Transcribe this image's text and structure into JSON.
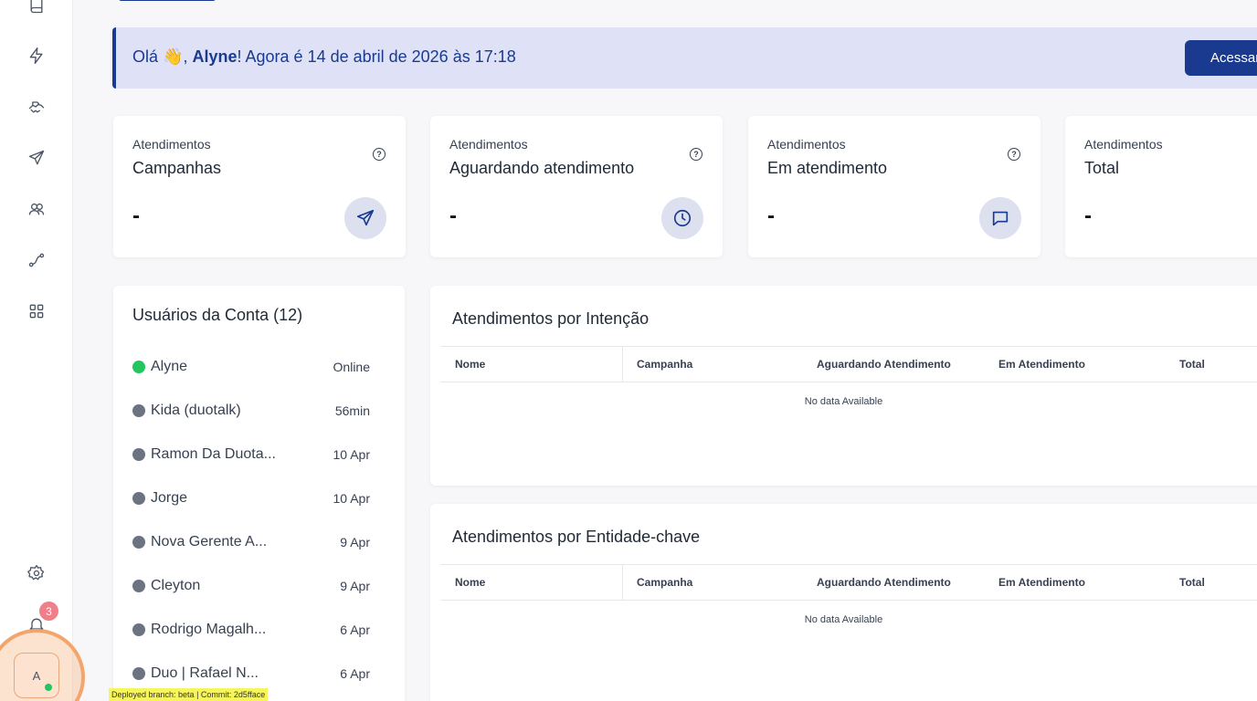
{
  "sidebar": {
    "icons": [
      "book-icon",
      "bolt-icon",
      "handshake-icon",
      "send-icon",
      "users-icon",
      "flow-icon",
      "grid-icon",
      "gear-icon",
      "bell-icon"
    ],
    "notification_count": "3",
    "avatar_initial": "A"
  },
  "banner": {
    "greeting": "Olá",
    "wave": "👋",
    "comma": ",",
    "user": "Alyne",
    "message": "! Agora é 14 de abril de 2026 às 17:18",
    "button": "Acessar"
  },
  "cards": [
    {
      "label": "Atendimentos",
      "title": "Campanhas",
      "value": "-",
      "icon": "send-icon",
      "help": "?"
    },
    {
      "label": "Atendimentos",
      "title": "Aguardando atendimento",
      "value": "-",
      "icon": "clock-icon",
      "help": "?"
    },
    {
      "label": "Atendimentos",
      "title": "Em atendimento",
      "value": "-",
      "icon": "chat-icon",
      "help": "?"
    },
    {
      "label": "Atendimentos",
      "title": "Total",
      "value": "-"
    }
  ],
  "users": {
    "title": "Usuários da Conta (12)",
    "list": [
      {
        "name": "Alyne",
        "time": "Online"
      },
      {
        "name": "Kida (duotalk)",
        "time": "56min"
      },
      {
        "name": "Ramon Da Duota...",
        "time": "10 Apr"
      },
      {
        "name": "Jorge",
        "time": "10 Apr"
      },
      {
        "name": "Nova Gerente A...",
        "time": "9 Apr"
      },
      {
        "name": "Cleyton",
        "time": "9 Apr"
      },
      {
        "name": "Rodrigo Magalh...",
        "time": "6 Apr"
      },
      {
        "name": "Duo | Rafael N...",
        "time": "6 Apr"
      }
    ]
  },
  "tables": [
    {
      "title": "Atendimentos por Intenção",
      "columns": [
        "Nome",
        "Campanha",
        "Aguardando Atendimento",
        "Em Atendimento",
        "Total"
      ],
      "empty": "No data Available"
    },
    {
      "title": "Atendimentos por Entidade-chave",
      "columns": [
        "Nome",
        "Campanha",
        "Aguardando Atendimento",
        "Em Atendimento",
        "Total"
      ],
      "empty": "No data Available"
    }
  ],
  "deploy": "Deployed branch: beta | Commit: 2d5fface",
  "colors": {
    "primary": "#1a3a8f",
    "banner_bg": "#dfe1f6",
    "online": "#22c55e",
    "offline": "#6b7280",
    "badge": "#ef7f89"
  }
}
